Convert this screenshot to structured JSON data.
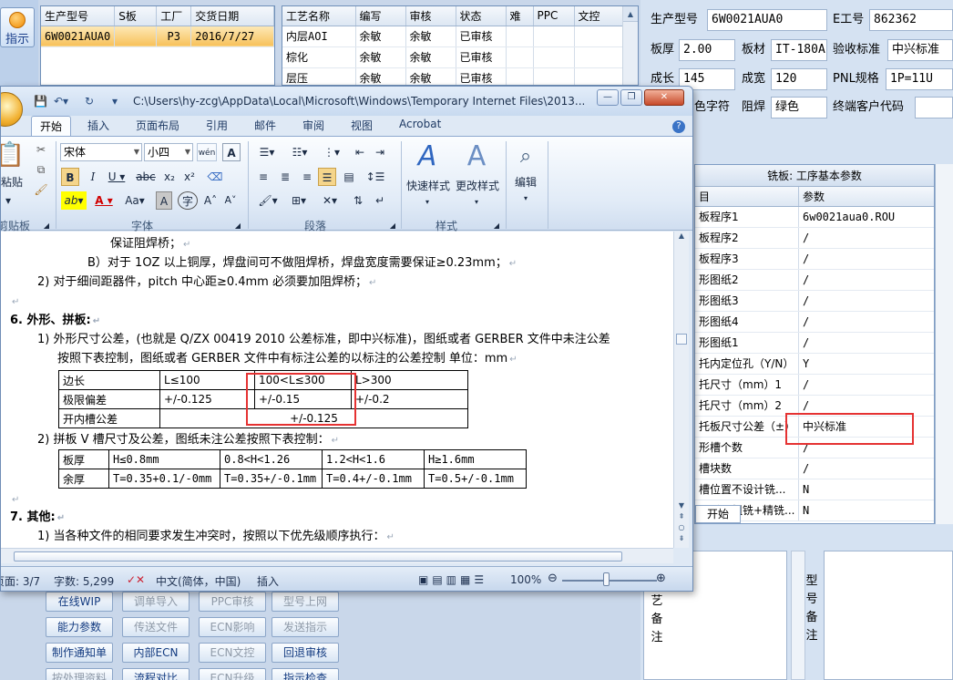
{
  "left_strip": {
    "button_label": "指示"
  },
  "top_grid": {
    "headers": [
      "生产型号",
      "S板",
      "工厂",
      "交货日期"
    ],
    "rows": [
      [
        "6W0021AUA0",
        "",
        "P3",
        "2016/7/27"
      ]
    ]
  },
  "process_grid": {
    "headers": [
      "工艺名称",
      "编写",
      "审核",
      "状态",
      "难",
      "PPC",
      "文控"
    ],
    "rows": [
      [
        "内层AOI",
        "余敏",
        "余敏",
        "已审核",
        "",
        "",
        ""
      ],
      [
        "棕化",
        "余敏",
        "余敏",
        "已审核",
        "",
        "",
        ""
      ],
      [
        "层压",
        "余敏",
        "余敏",
        "已审核",
        "",
        "",
        ""
      ]
    ]
  },
  "right_panel": {
    "model_label": "生产型号",
    "model_value": "6W0021AUA0",
    "eno_label": "E工号",
    "eno_value": "862362",
    "thickness_label": "板厚",
    "thickness_value": "2.00",
    "material_label": "板材",
    "material_value": "IT-180A",
    "standard_label": "验收标准",
    "standard_value": "中兴标准",
    "length_label": "成长",
    "length_value": "145",
    "width_label": "成宽",
    "width_value": "120",
    "pnl_label": "PNL规格",
    "pnl_value": "1P=11U",
    "char_label": "色字符",
    "mask_label": "阻焊",
    "mask_value": "绿色",
    "customer_code_label": "终端客户代码",
    "param_title": "铣板: 工序基本参数",
    "param_head_1": "目",
    "param_head_2": "参数",
    "params": [
      [
        "板程序1",
        "6w0021aua0.ROU"
      ],
      [
        "板程序2",
        "/"
      ],
      [
        "板程序3",
        "/"
      ],
      [
        "形图纸2",
        "/"
      ],
      [
        "形图纸3",
        "/"
      ],
      [
        "形图纸4",
        "/"
      ],
      [
        "形图纸1",
        "/"
      ],
      [
        "托内定位孔（Y/N）",
        "Y"
      ],
      [
        "托尺寸（mm）1",
        "/"
      ],
      [
        "托尺寸（mm）2",
        "/"
      ],
      [
        "托板尺寸公差（±）",
        "中兴标准"
      ],
      [
        "形槽个数",
        "/"
      ],
      [
        "槽块数",
        "/"
      ],
      [
        "槽位置不设计铣...",
        "N"
      ],
      [
        "形采用粗铣+精铣...",
        "N"
      ]
    ],
    "start_tab": "开始",
    "note_left": "艺备注",
    "note_right": "型号备注"
  },
  "bottom_buttons": [
    [
      "在线WIP",
      "act"
    ],
    [
      "调单导入",
      "dis"
    ],
    [
      "PPC审核",
      "dis"
    ],
    [
      "型号上网",
      "dis"
    ],
    [
      "能力参数",
      "act"
    ],
    [
      "传送文件",
      "dis"
    ],
    [
      "ECN影响",
      "dis"
    ],
    [
      "发送指示",
      "dis"
    ],
    [
      "制作通知单",
      "act"
    ],
    [
      "内部ECN",
      "act"
    ],
    [
      "ECN文控",
      "dis"
    ],
    [
      "回退审核",
      "act"
    ],
    [
      "按处理资料",
      "dis"
    ],
    [
      "流程对比",
      "act"
    ],
    [
      "ECN升级",
      "dis"
    ],
    [
      "指示检查",
      "act"
    ]
  ],
  "word": {
    "title": "C:\\Users\\hy-zcg\\AppData\\Local\\Microsoft\\Windows\\Temporary Internet Files\\2013...",
    "tabs": [
      "开始",
      "插入",
      "页面布局",
      "引用",
      "邮件",
      "审阅",
      "视图",
      "Acrobat"
    ],
    "font_name": "宋体",
    "font_size": "小四",
    "groups": {
      "clipboard": "剪贴板",
      "font": "字体",
      "paragraph": "段落",
      "styles": "样式"
    },
    "paste_label": "粘贴",
    "quick_style": "快速样式",
    "change_style": "更改样式",
    "edit_label": "编辑",
    "doc": {
      "l1": "保证阻焊桥；",
      "l2": "B）对于 1OZ 以上铜厚，焊盘间可不做阻焊桥，焊盘宽度需要保证≥0.23mm；",
      "l3": "2)  对于细间距器件，pitch 中心距≥0.4mm 必须要加阻焊桥；",
      "h6": "6.  外形、拼板:",
      "l4": "1)  外形尺寸公差，(也就是 Q/ZX 00419 2010 公差标准，即中兴标准)，图纸或者 GERBER 文件中未注公差",
      "l5": "按照下表控制，图纸或者 GERBER 文件中有标注公差的以标注的公差控制   单位：mm",
      "t1": [
        [
          "边长",
          "L≤100",
          "100<L≤300",
          "L>300"
        ],
        [
          "极限偏差",
          "+/-0.125",
          "+/-0.15",
          "+/-0.2"
        ],
        [
          "开内槽公差",
          "+/-0.125"
        ]
      ],
      "l6": "2)  拼板 V 槽尺寸及公差，图纸未注公差按照下表控制：",
      "t2": [
        [
          "板厚",
          "H≤0.8mm",
          "0.8<H<1.26",
          "1.2<H<1.6",
          "H≥1.6mm"
        ],
        [
          "余厚",
          "T=0.35+0.1/-0mm",
          "T=0.35+/-0.1mm",
          "T=0.4+/-0.1mm",
          "T=0.5+/-0.1mm"
        ]
      ],
      "h7": "7.  其他:",
      "l7": "1)  当各种文件的相同要求发生冲突时，按照以下优先级顺序执行："
    },
    "status": {
      "page": "页面: 3/7",
      "words": "字数: 5,299",
      "lang": "中文(简体，中国)",
      "mode": "插入",
      "zoom": "100%"
    }
  },
  "colors": {
    "highlight_box": "#e53232",
    "selected_row": "#f7c15a"
  }
}
